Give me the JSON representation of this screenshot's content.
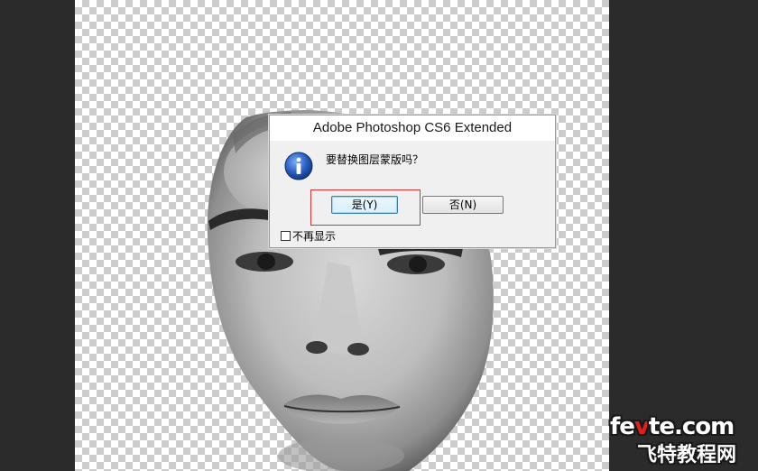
{
  "dialog": {
    "title": "Adobe Photoshop CS6 Extended",
    "icon": "info-icon",
    "message": "要替换图层蒙版吗？",
    "yes_label": "是(Y)",
    "no_label": "否(N)",
    "dont_show_label": "不再显示"
  },
  "watermark": {
    "site_prefix": "fe",
    "site_red": "v",
    "site_suffix": "te.com",
    "site_cn": "飞特教程网"
  },
  "colors": {
    "workspace_bg": "#2b2b2b",
    "highlight": "#e03030",
    "info_icon_blue": "#1f4fa8"
  }
}
